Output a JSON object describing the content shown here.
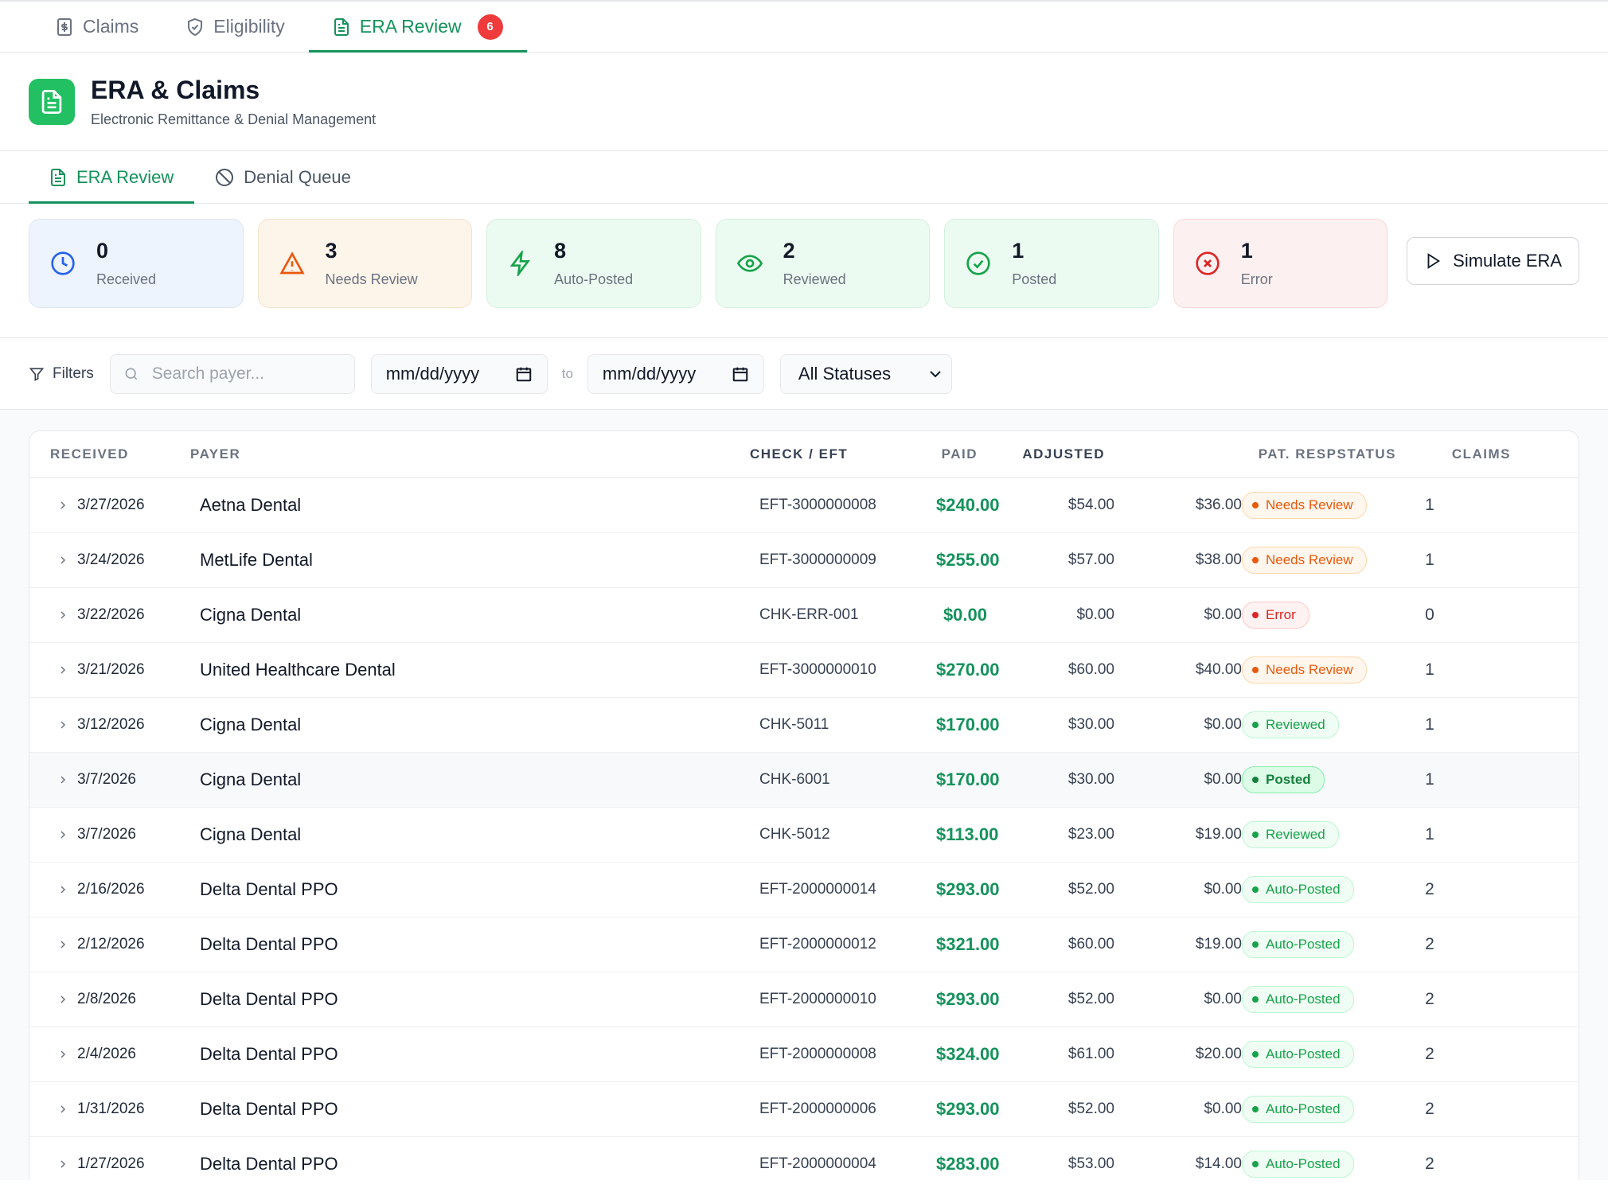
{
  "top_tabs": [
    {
      "label": "Claims",
      "icon": "dollar-doc-icon"
    },
    {
      "label": "Eligibility",
      "icon": "shield-check-icon"
    },
    {
      "label": "ERA Review",
      "icon": "document-icon",
      "badge": "6",
      "active": true
    }
  ],
  "header": {
    "title": "ERA & Claims",
    "subtitle": "Electronic Remittance & Denial Management",
    "accent_color": "#22c062"
  },
  "sub_tabs": [
    {
      "label": "ERA Review",
      "icon": "document-icon",
      "active": true
    },
    {
      "label": "Denial Queue",
      "icon": "ban-icon"
    }
  ],
  "stats": [
    {
      "count": "0",
      "label": "Received",
      "icon": "clock-icon",
      "color": "#2563eb"
    },
    {
      "count": "3",
      "label": "Needs Review",
      "icon": "warning-icon",
      "color": "#ea580c"
    },
    {
      "count": "8",
      "label": "Auto-Posted",
      "icon": "lightning-icon",
      "color": "#16a34a"
    },
    {
      "count": "2",
      "label": "Reviewed",
      "icon": "eye-icon",
      "color": "#16a34a"
    },
    {
      "count": "1",
      "label": "Posted",
      "icon": "check-circle-icon",
      "color": "#16a34a"
    },
    {
      "count": "1",
      "label": "Error",
      "icon": "x-circle-icon",
      "color": "#dc2626"
    }
  ],
  "simulate_button": {
    "label": "Simulate ERA",
    "icon": "play-icon"
  },
  "filters": {
    "label": "Filters",
    "search_placeholder": "Search payer...",
    "date_from": "mm/dd/yyyy",
    "to_label": "to",
    "date_to": "mm/dd/yyyy",
    "status_select": "All Statuses"
  },
  "table": {
    "columns": {
      "received": "RECEIVED",
      "payer": "PAYER",
      "check": "CHECK / EFT",
      "paid": "PAID",
      "adjusted": "ADJUSTED",
      "patstatus": "PAT. RESPSTATUS",
      "claims": "CLAIMS"
    },
    "rows": [
      {
        "received": "3/27/2026",
        "payer": "Aetna Dental",
        "check": "EFT-3000000008",
        "paid": "$240.00",
        "adjusted": "$54.00",
        "pat_resp": "$36.00",
        "status": "Needs Review",
        "status_kind": "needs",
        "claims": "1"
      },
      {
        "received": "3/24/2026",
        "payer": "MetLife Dental",
        "check": "EFT-3000000009",
        "paid": "$255.00",
        "adjusted": "$57.00",
        "pat_resp": "$38.00",
        "status": "Needs Review",
        "status_kind": "needs",
        "claims": "1"
      },
      {
        "received": "3/22/2026",
        "payer": "Cigna Dental",
        "check": "CHK-ERR-001",
        "paid": "$0.00",
        "adjusted": "$0.00",
        "pat_resp": "$0.00",
        "status": "Error",
        "status_kind": "error",
        "claims": "0"
      },
      {
        "received": "3/21/2026",
        "payer": "United Healthcare Dental",
        "check": "EFT-3000000010",
        "paid": "$270.00",
        "adjusted": "$60.00",
        "pat_resp": "$40.00",
        "status": "Needs Review",
        "status_kind": "needs",
        "claims": "1"
      },
      {
        "received": "3/12/2026",
        "payer": "Cigna Dental",
        "check": "CHK-5011",
        "paid": "$170.00",
        "adjusted": "$30.00",
        "pat_resp": "$0.00",
        "status": "Reviewed",
        "status_kind": "reviewed",
        "claims": "1"
      },
      {
        "received": "3/7/2026",
        "payer": "Cigna Dental",
        "check": "CHK-6001",
        "paid": "$170.00",
        "adjusted": "$30.00",
        "pat_resp": "$0.00",
        "status": "Posted",
        "status_kind": "posted",
        "claims": "1",
        "highlighted": true
      },
      {
        "received": "3/7/2026",
        "payer": "Cigna Dental",
        "check": "CHK-5012",
        "paid": "$113.00",
        "adjusted": "$23.00",
        "pat_resp": "$19.00",
        "status": "Reviewed",
        "status_kind": "reviewed",
        "claims": "1"
      },
      {
        "received": "2/16/2026",
        "payer": "Delta Dental PPO",
        "check": "EFT-2000000014",
        "paid": "$293.00",
        "adjusted": "$52.00",
        "pat_resp": "$0.00",
        "status": "Auto-Posted",
        "status_kind": "auto",
        "claims": "2"
      },
      {
        "received": "2/12/2026",
        "payer": "Delta Dental PPO",
        "check": "EFT-2000000012",
        "paid": "$321.00",
        "adjusted": "$60.00",
        "pat_resp": "$19.00",
        "status": "Auto-Posted",
        "status_kind": "auto",
        "claims": "2"
      },
      {
        "received": "2/8/2026",
        "payer": "Delta Dental PPO",
        "check": "EFT-2000000010",
        "paid": "$293.00",
        "adjusted": "$52.00",
        "pat_resp": "$0.00",
        "status": "Auto-Posted",
        "status_kind": "auto",
        "claims": "2"
      },
      {
        "received": "2/4/2026",
        "payer": "Delta Dental PPO",
        "check": "EFT-2000000008",
        "paid": "$324.00",
        "adjusted": "$61.00",
        "pat_resp": "$20.00",
        "status": "Auto-Posted",
        "status_kind": "auto",
        "claims": "2"
      },
      {
        "received": "1/31/2026",
        "payer": "Delta Dental PPO",
        "check": "EFT-2000000006",
        "paid": "$293.00",
        "adjusted": "$52.00",
        "pat_resp": "$0.00",
        "status": "Auto-Posted",
        "status_kind": "auto",
        "claims": "2"
      },
      {
        "received": "1/27/2026",
        "payer": "Delta Dental PPO",
        "check": "EFT-2000000004",
        "paid": "$283.00",
        "adjusted": "$53.00",
        "pat_resp": "$14.00",
        "status": "Auto-Posted",
        "status_kind": "auto",
        "claims": "2"
      }
    ]
  }
}
